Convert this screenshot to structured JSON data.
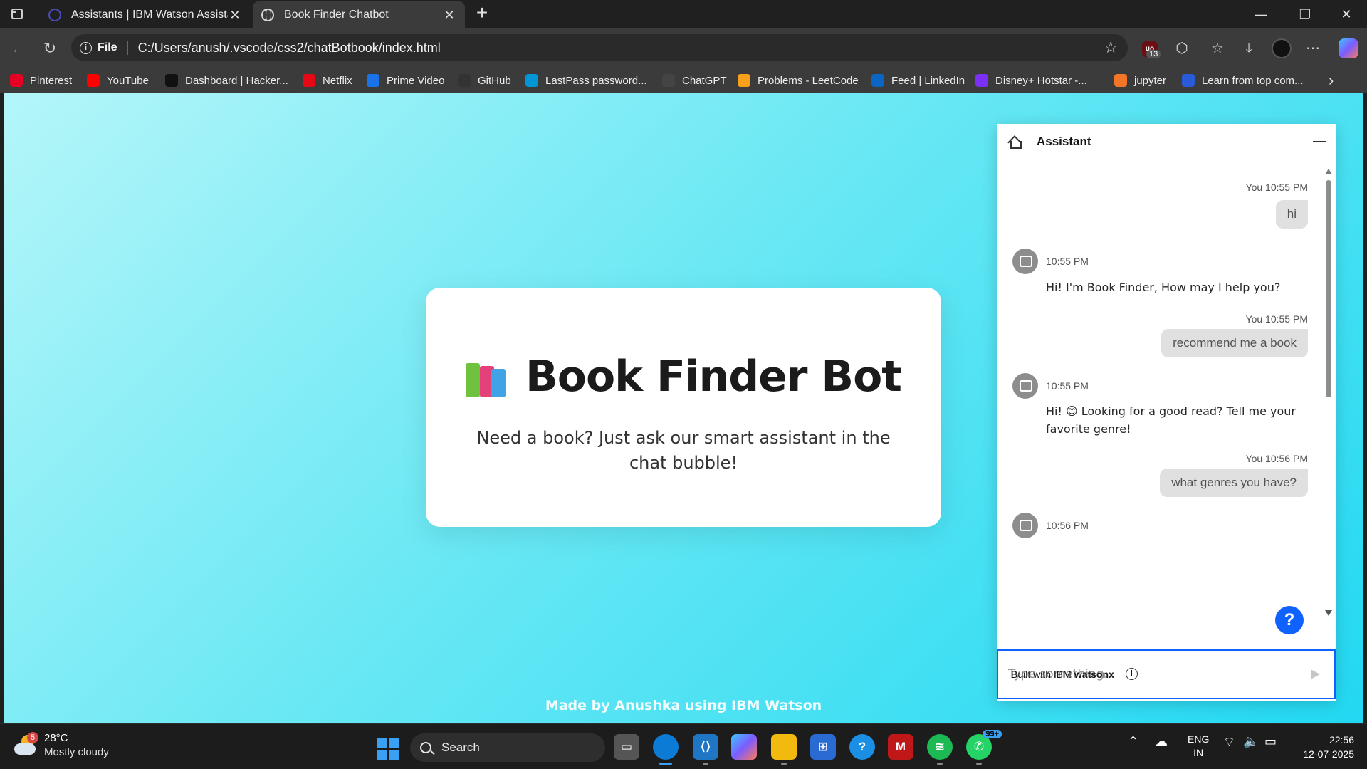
{
  "browser": {
    "tabs": [
      {
        "title": "Assistants | IBM Watson Assistant",
        "active": false
      },
      {
        "title": "Book Finder Chatbot",
        "active": true
      }
    ],
    "address": {
      "scheme_label": "File",
      "url": "C:/Users/anush/.vscode/css2/chatBotbook/index.html"
    },
    "extensions": {
      "ublock_count": "13"
    },
    "bookmarks": [
      {
        "label": "Pinterest",
        "icon": "pinterest-icon",
        "color": "#e60023"
      },
      {
        "label": "YouTube",
        "icon": "youtube-icon",
        "color": "#ff0000"
      },
      {
        "label": "Dashboard | Hacker...",
        "icon": "hackerrank-icon",
        "color": "#111111"
      },
      {
        "label": "Netflix",
        "icon": "netflix-icon",
        "color": "#e50914"
      },
      {
        "label": "Prime Video",
        "icon": "prime-video-icon",
        "color": "#1a73e8"
      },
      {
        "label": "GitHub",
        "icon": "github-icon",
        "color": "#333333"
      },
      {
        "label": "LastPass password...",
        "icon": "hp-icon",
        "color": "#0096d6"
      },
      {
        "label": "ChatGPT",
        "icon": "chatgpt-icon",
        "color": "#444444"
      },
      {
        "label": "Problems - LeetCode",
        "icon": "leetcode-icon",
        "color": "#f89f1b"
      },
      {
        "label": "Feed | LinkedIn",
        "icon": "linkedin-icon",
        "color": "#0a66c2"
      },
      {
        "label": "Disney+ Hotstar -...",
        "icon": "hotstar-icon",
        "color": "#7b2ff7"
      },
      {
        "label": "jupyter",
        "icon": "jupyter-icon",
        "color": "#f37626"
      },
      {
        "label": "Learn from top com...",
        "icon": "diamond-icon",
        "color": "#2a5bd7"
      }
    ]
  },
  "page": {
    "title": "Book Finder Bot",
    "title_emoji": "📚",
    "subtitle": "Need a book? Just ask our smart assistant in the chat bubble!",
    "footer": "Made by Anushka using IBM Watson",
    "gradient_colors": [
      "#b4f6f9",
      "#22d8f2"
    ]
  },
  "chat": {
    "title": "Assistant",
    "messages": [
      {
        "from": "user",
        "meta": "You 10:55 PM",
        "text": "hi"
      },
      {
        "from": "bot",
        "time": "10:55 PM",
        "text": "Hi! I'm Book Finder, How may I help you?"
      },
      {
        "from": "user",
        "meta": "You 10:55 PM",
        "text": "recommend me a book"
      },
      {
        "from": "bot",
        "time": "10:55 PM",
        "text": "Hi! 😊 Looking for a good read? Tell me your favorite genre!"
      },
      {
        "from": "user",
        "meta": "You 10:56 PM",
        "text": "what genres you have?"
      },
      {
        "from": "bot",
        "time": "10:56 PM",
        "text": ""
      }
    ],
    "input_placeholder": "Type something...",
    "footer_prefix": "Built with IBM",
    "footer_brand": "watsonx",
    "help_label": "?",
    "accent": "#0f62fe"
  },
  "taskbar": {
    "weather": {
      "badge": "5",
      "temp": "28°C",
      "condition": "Mostly cloudy"
    },
    "search_label": "Search",
    "notification_badge": "99+",
    "language": {
      "line1": "ENG",
      "line2": "IN"
    },
    "time": "22:56",
    "date": "12-07-2025"
  }
}
